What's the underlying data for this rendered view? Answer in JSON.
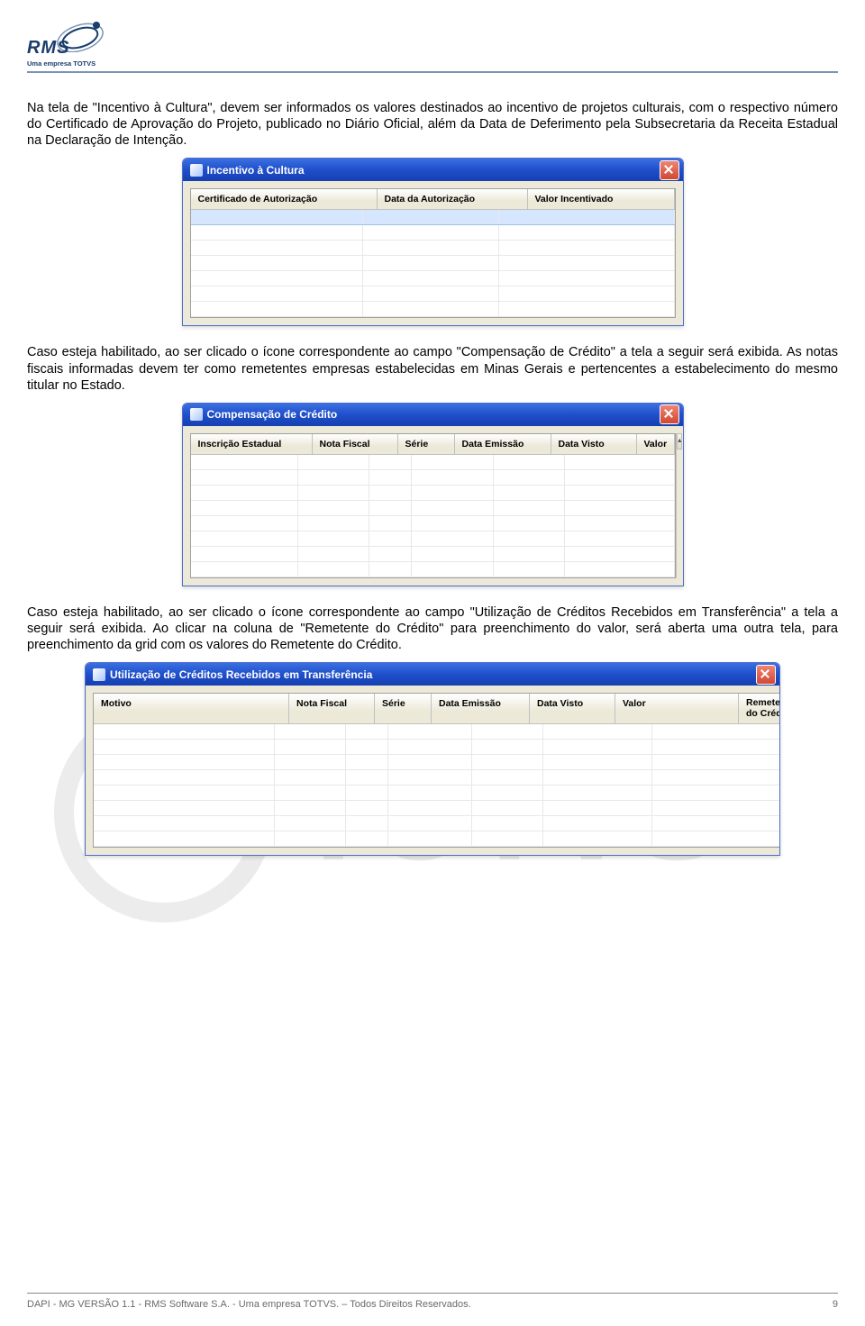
{
  "logo": {
    "main": "RMS",
    "sub": "Uma empresa TOTVS"
  },
  "para1": "Na tela de \"Incentivo à Cultura\", devem ser informados os valores destinados ao incentivo de projetos culturais, com o respectivo número do Certificado de Aprovação do Projeto, publicado no Diário Oficial, além da Data de Deferimento pela Subsecretaria da Receita Estadual na Declaração de Intenção.",
  "window1": {
    "title": "Incentivo à Cultura",
    "columns": [
      "Certificado de Autorização",
      "Data da Autorização",
      "Valor Incentivado"
    ]
  },
  "para2": "Caso esteja habilitado, ao ser clicado o ícone correspondente ao campo \"Compensação de Crédito\" a tela a seguir será exibida. As notas fiscais informadas devem ter como remetentes empresas estabelecidas em Minas Gerais e pertencentes a estabelecimento do mesmo titular no Estado.",
  "window2": {
    "title": "Compensação de Crédito",
    "columns": [
      "Inscrição Estadual",
      "Nota Fiscal",
      "Série",
      "Data Emissão",
      "Data Visto",
      "Valor"
    ]
  },
  "para3": "Caso esteja habilitado, ao ser clicado o ícone correspondente ao campo \"Utilização de Créditos Recebidos em Transferência\" a tela a seguir será exibida. Ao clicar na coluna de \"Remetente do Crédito\" para preenchimento do valor, será aberta uma outra tela, para preenchimento da grid com os valores do Remetente do Crédito.",
  "window3": {
    "title": "Utilização de Créditos Recebidos em Transferência",
    "columns": [
      "Motivo",
      "Nota Fiscal",
      "Série",
      "Data Emissão",
      "Data Visto",
      "Valor",
      "Remetente do Crédito"
    ]
  },
  "watermark": "TOTVS",
  "footer": {
    "left": "DAPI - MG VERSÃO 1.1 - RMS Software S.A.  - Uma empresa TOTVS. – Todos Direitos Reservados.",
    "right": "9"
  }
}
